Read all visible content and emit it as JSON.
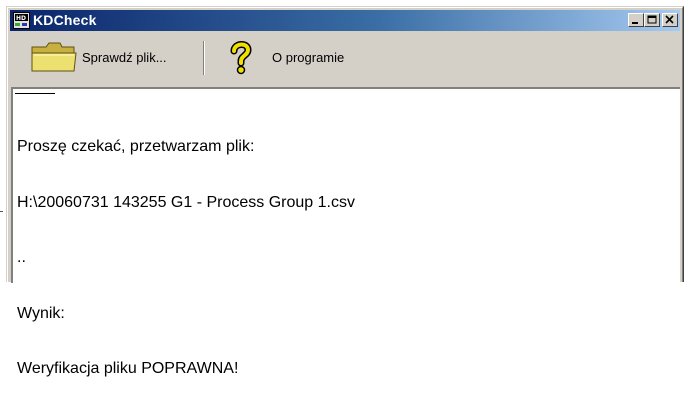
{
  "window": {
    "title": "KDCheck",
    "icon": "hd-app-icon",
    "controls": [
      "minimize-icon",
      "maximize-icon",
      "close-icon"
    ]
  },
  "toolbar": {
    "check_label": "Sprawdź plik...",
    "about_label": "O programie"
  },
  "output": {
    "line1": "Proszę czekać, przetwarzam plik:",
    "line2": "H:\\20060731 143255 G1 - Process Group 1.csv",
    "line3": "..",
    "line4": "Wynik:",
    "line5": "Weryfikacja pliku POPRAWNA!"
  },
  "colors": {
    "titlebar_start": "#0a246a",
    "titlebar_end": "#a6caf0",
    "face": "#d4d0c8",
    "folder": "#e8d860",
    "question_mark": "#f0e000"
  }
}
